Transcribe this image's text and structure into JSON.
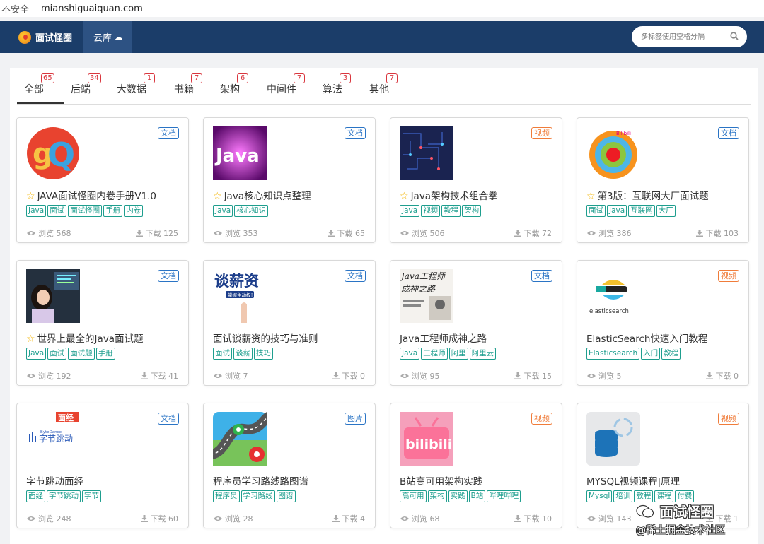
{
  "browser": {
    "insecure_label": "不安全",
    "url": "mianshiguaiquan.com"
  },
  "nav": {
    "brand": "面试怪圈",
    "tab_label": "云库",
    "search_placeholder": "多标签使用空格分隔"
  },
  "tabs": [
    {
      "label": "全部",
      "count": "65"
    },
    {
      "label": "后端",
      "count": "34"
    },
    {
      "label": "大数据",
      "count": "1"
    },
    {
      "label": "书籍",
      "count": "7"
    },
    {
      "label": "架构",
      "count": "6"
    },
    {
      "label": "中间件",
      "count": "7"
    },
    {
      "label": "算法",
      "count": "3"
    },
    {
      "label": "其他",
      "count": "7"
    }
  ],
  "labels": {
    "views_prefix": "浏览",
    "downloads_prefix": "下载"
  },
  "cards": [
    {
      "title": "JAVA面试怪圈内卷手册V1.0",
      "starred": true,
      "type": "文档",
      "tags": [
        "Java",
        "面试",
        "面试怪圈",
        "手册",
        "内卷"
      ],
      "views": "568",
      "downloads": "125"
    },
    {
      "title": "Java核心知识点整理",
      "starred": true,
      "type": "文档",
      "tags": [
        "Java",
        "核心知识"
      ],
      "views": "353",
      "downloads": "65"
    },
    {
      "title": "Java架构技术组合拳",
      "starred": true,
      "type": "视频",
      "tags": [
        "Java",
        "视频",
        "教程",
        "架构"
      ],
      "views": "506",
      "downloads": "72"
    },
    {
      "title": "第3版：互联网大厂面试题",
      "starred": true,
      "type": "文档",
      "tags": [
        "面试",
        "Java",
        "互联网",
        "大厂"
      ],
      "views": "386",
      "downloads": "103"
    },
    {
      "title": "世界上最全的Java面试题",
      "starred": true,
      "type": "文档",
      "tags": [
        "Java",
        "面试",
        "面试题",
        "手册"
      ],
      "views": "192",
      "downloads": "41"
    },
    {
      "title": "面试谈薪资的技巧与准则",
      "starred": false,
      "type": "文档",
      "tags": [
        "面试",
        "谈薪",
        "技巧"
      ],
      "views": "7",
      "downloads": "0"
    },
    {
      "title": "Java工程师成神之路",
      "starred": false,
      "type": "文档",
      "tags": [
        "Java",
        "工程师",
        "阿里",
        "阿里云"
      ],
      "views": "95",
      "downloads": "15"
    },
    {
      "title": "ElasticSearch快速入门教程",
      "starred": false,
      "type": "视频",
      "tags": [
        "Elasticsearch",
        "入门",
        "教程"
      ],
      "views": "5",
      "downloads": "0"
    },
    {
      "title": "字节跳动面经",
      "starred": false,
      "type": "文档",
      "tags": [
        "面经",
        "字节跳动",
        "字节"
      ],
      "views": "248",
      "downloads": "60"
    },
    {
      "title": "程序员学习路线路图谱",
      "starred": false,
      "type": "图片",
      "tags": [
        "程序员",
        "学习路线",
        "图谱"
      ],
      "views": "28",
      "downloads": "4"
    },
    {
      "title": "B站高可用架构实践",
      "starred": false,
      "type": "视频",
      "tags": [
        "高可用",
        "架构",
        "实践",
        "B站",
        "哔哩哔哩"
      ],
      "views": "68",
      "downloads": "10"
    },
    {
      "title": "MYSQL视频课程|原理",
      "starred": false,
      "type": "视频",
      "tags": [
        "Mysql",
        "培训",
        "教程",
        "课程",
        "付费"
      ],
      "views": "143",
      "downloads": "1"
    }
  ],
  "thumb_text": {
    "card1": "gQ",
    "card2": "Java",
    "card4": "Bilibili",
    "card6_main": "谈薪资",
    "card6_sub": "掌握主动权?",
    "card7_line1": "Java工程师",
    "card7_line2": "成神之路",
    "card8": "elasticsearch",
    "card9_badge": "面经",
    "card9_brand_small": "ByteDance",
    "card9_brand": "字节跳动",
    "card11": "bilibili"
  },
  "watermark": {
    "line1": "面试怪圈",
    "line2": "@稀土掘金技术社区"
  },
  "colors": {
    "nav_bg": "#1b3d69",
    "tag": "#1e9e8e",
    "badge": "#d9363e",
    "doc": "#2a74c5",
    "video": "#f07c3a"
  }
}
